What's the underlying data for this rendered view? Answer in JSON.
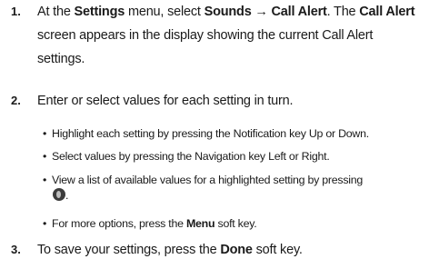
{
  "steps": [
    {
      "number": "1.",
      "parts": [
        "At the ",
        "Settings",
        " menu, select ",
        "Sounds → Call Alert",
        ". The ",
        "Call Alert",
        " screen appears in the display showing the current Call Alert settings."
      ]
    },
    {
      "number": "2.",
      "text": "Enter or select values for each setting in turn.",
      "bullets": [
        {
          "text": "Highlight each setting by pressing the Notification key Up or Down."
        },
        {
          "text": "Select values by pressing the Navigation key Left or Right."
        },
        {
          "text": "View a list of available values for a highlighted setting by pressing",
          "tail": ".",
          "icon": "navigation-key-icon"
        },
        {
          "pre": "For more options, press the ",
          "bold": "Menu",
          "post": " soft key."
        }
      ]
    },
    {
      "number": "3.",
      "parts": [
        "To save your settings, press the ",
        "Done",
        " soft key."
      ]
    }
  ],
  "bullet_glyph": "•"
}
